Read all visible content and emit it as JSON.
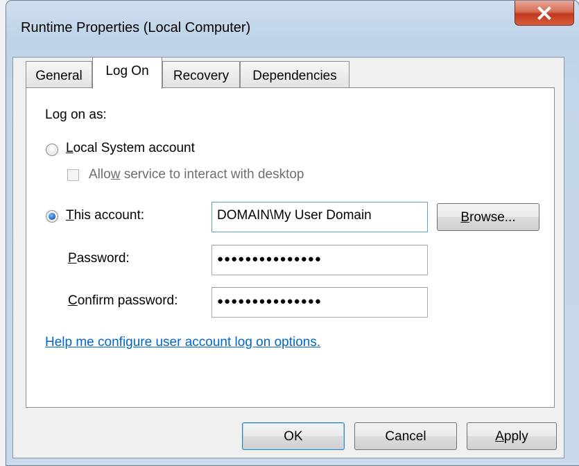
{
  "window": {
    "title": "Runtime Properties (Local Computer)",
    "close_icon": "close-x-icon"
  },
  "tabs": [
    {
      "label": "General",
      "active": false
    },
    {
      "label": "Log On",
      "active": true
    },
    {
      "label": "Recovery",
      "active": false
    },
    {
      "label": "Dependencies",
      "active": false
    }
  ],
  "logon": {
    "log_on_as_label": "Log on as:",
    "local_system": {
      "label_first": "L",
      "label_rest": "ocal System account",
      "selected": false
    },
    "interact_desktop": {
      "label_a": "Allo",
      "label_b": "w",
      "label_c": " service to interact with desktop",
      "checked": false,
      "enabled": false
    },
    "this_account": {
      "label_first": "T",
      "label_rest": "his account:",
      "selected": true,
      "value": "DOMAIN\\My User Domain"
    },
    "browse": {
      "label_first": "B",
      "label_rest": "rowse..."
    },
    "password": {
      "label_first": "P",
      "label_rest": "assword:",
      "value": "●●●●●●●●●●●●●●●"
    },
    "confirm": {
      "label_first": "C",
      "label_rest": "onfirm password:",
      "value": "●●●●●●●●●●●●●●●"
    },
    "help_link": "Help me configure user account log on options."
  },
  "buttons": {
    "ok": "OK",
    "cancel": "Cancel",
    "apply_first": "A",
    "apply_rest": "pply"
  }
}
